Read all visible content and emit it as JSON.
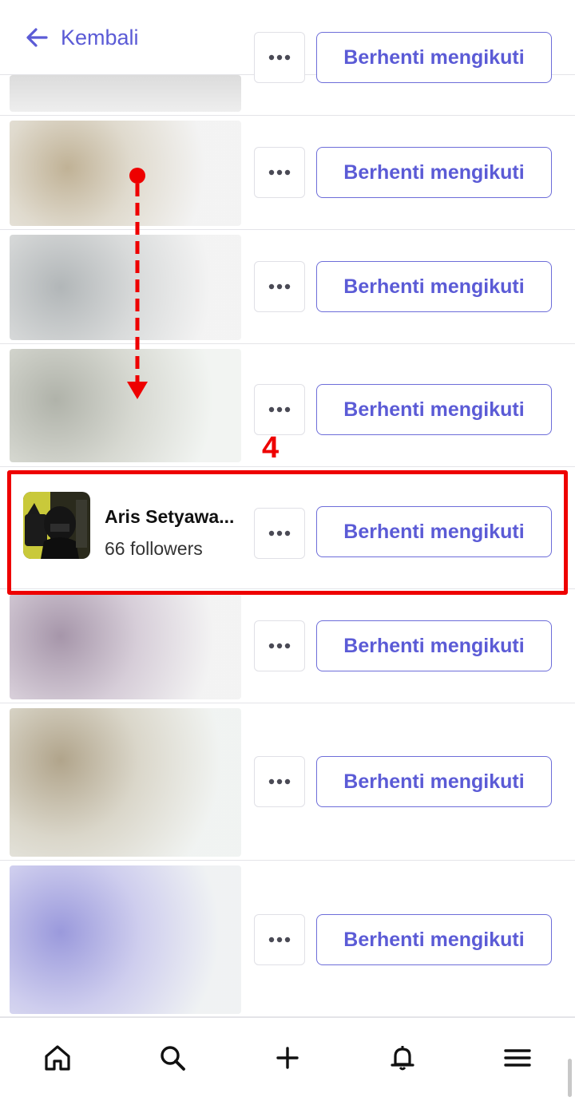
{
  "header": {
    "back_label": "Kembali",
    "back_icon": "arrow-left-icon"
  },
  "following_list": {
    "unfollow_label": "Berhenti mengikuti",
    "more_icon": "more-horizontal-icon",
    "highlighted_user": {
      "name": "Aris Setyawa...",
      "followers": "66 followers"
    }
  },
  "annotation": {
    "step_number": "4",
    "color": "#ee0000"
  },
  "bottom_nav": {
    "items": [
      {
        "icon": "home-icon"
      },
      {
        "icon": "search-icon"
      },
      {
        "icon": "plus-icon"
      },
      {
        "icon": "bell-icon"
      },
      {
        "icon": "menu-icon"
      }
    ]
  },
  "colors": {
    "accent": "#5b5bd6",
    "divider": "#e4e4e8",
    "annotation_red": "#ee0000"
  }
}
